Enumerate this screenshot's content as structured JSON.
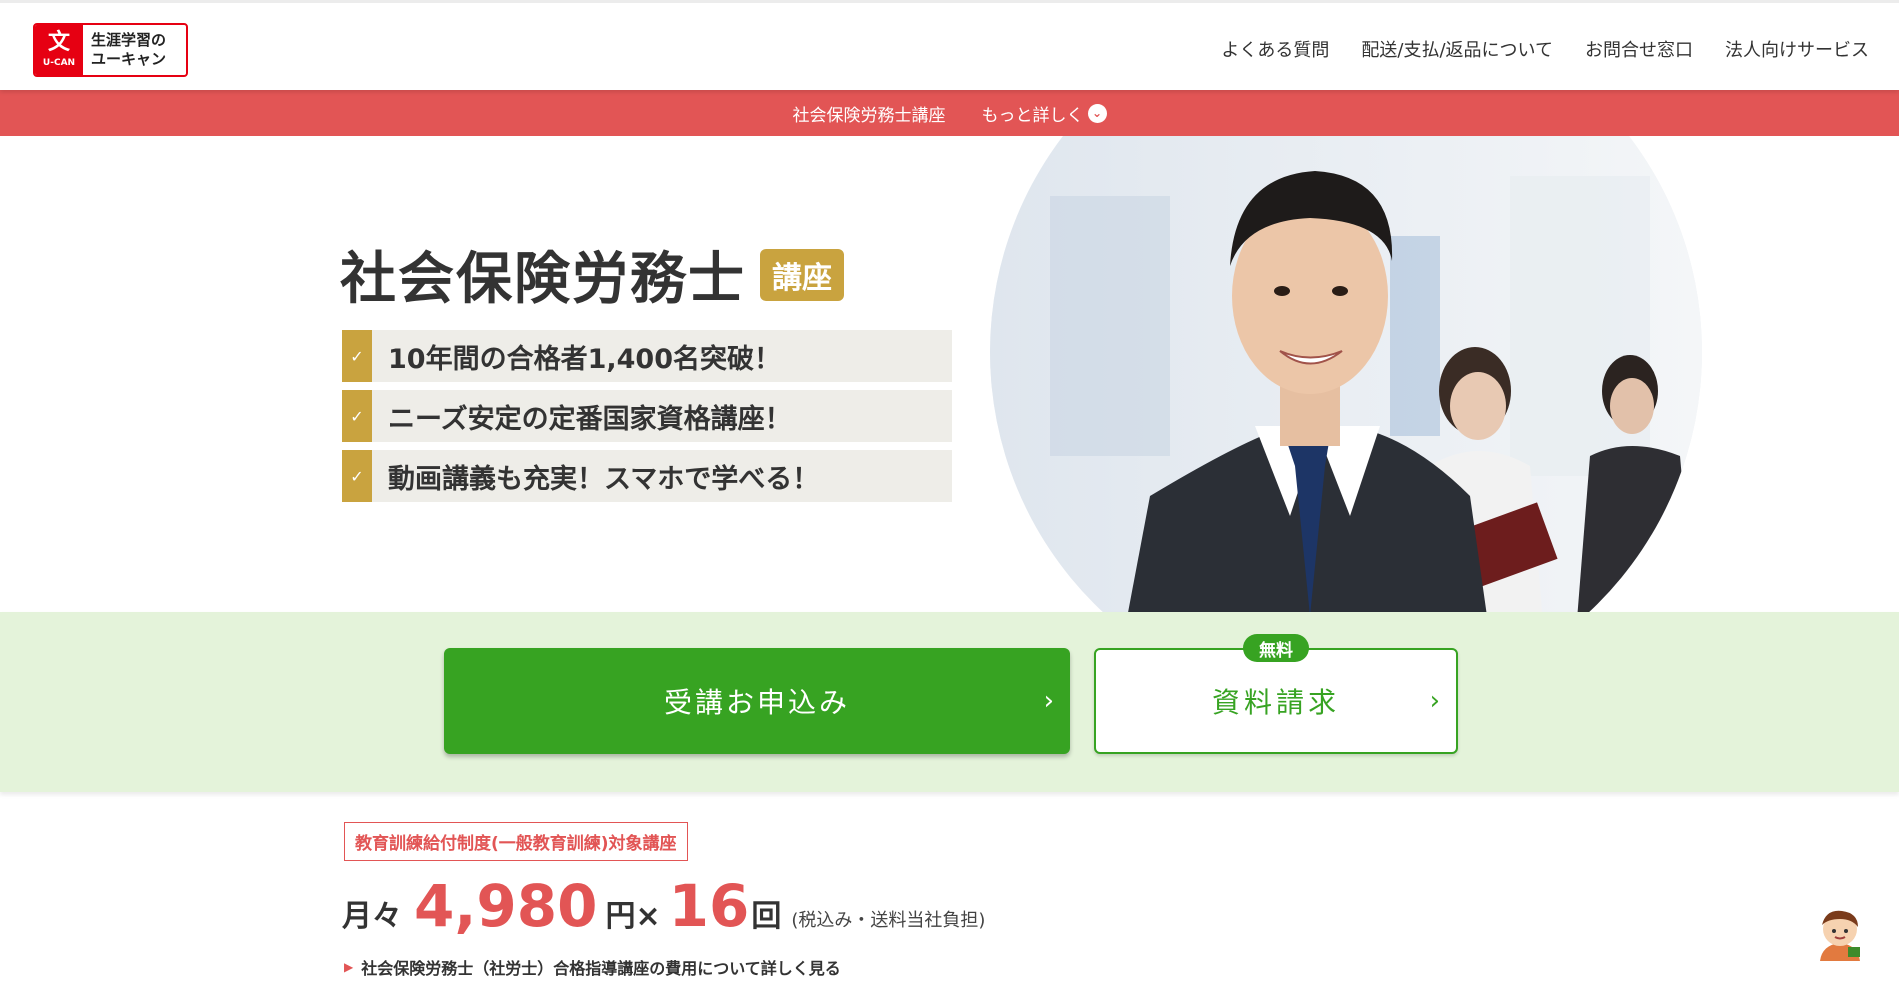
{
  "header": {
    "logo": {
      "mark": "U-CAN",
      "line1": "生涯学習の",
      "line2": "ユーキャン"
    },
    "nav": [
      {
        "label": "よくある質問"
      },
      {
        "label": "配送/支払/返品について"
      },
      {
        "label": "お問合せ窓口"
      },
      {
        "label": "法人向けサービス"
      }
    ]
  },
  "subnav": {
    "course": "社会保険労務士講座",
    "more": "もっと詳しく"
  },
  "hero": {
    "title": "社会保険労務士",
    "title_badge": "講座",
    "features": [
      "10年間の合格者1,400名突破！",
      "ニーズ安定の定番国家資格講座！",
      "動画講義も充実！スマホで学べる！"
    ]
  },
  "cta": {
    "apply_label": "受講お申込み",
    "request_label": "資料請求",
    "free_badge": "無料",
    "arrow": "›"
  },
  "price": {
    "kyufu_label": "教育訓練給付制度(一般教育訓練)対象講座",
    "prefix": "月々",
    "amount": "4,980",
    "unit": "円×",
    "count": "16",
    "count_unit": "回",
    "note": "(税込み・送料当社負担)",
    "detail_link": "社会保険労務士（社労士）合格指導講座の費用について詳しく見る"
  },
  "colors": {
    "brand_red": "#e60012",
    "subnav_red": "#e25555",
    "gold": "#c9a33f",
    "green": "#37a322",
    "band_green": "#e4f3da"
  }
}
